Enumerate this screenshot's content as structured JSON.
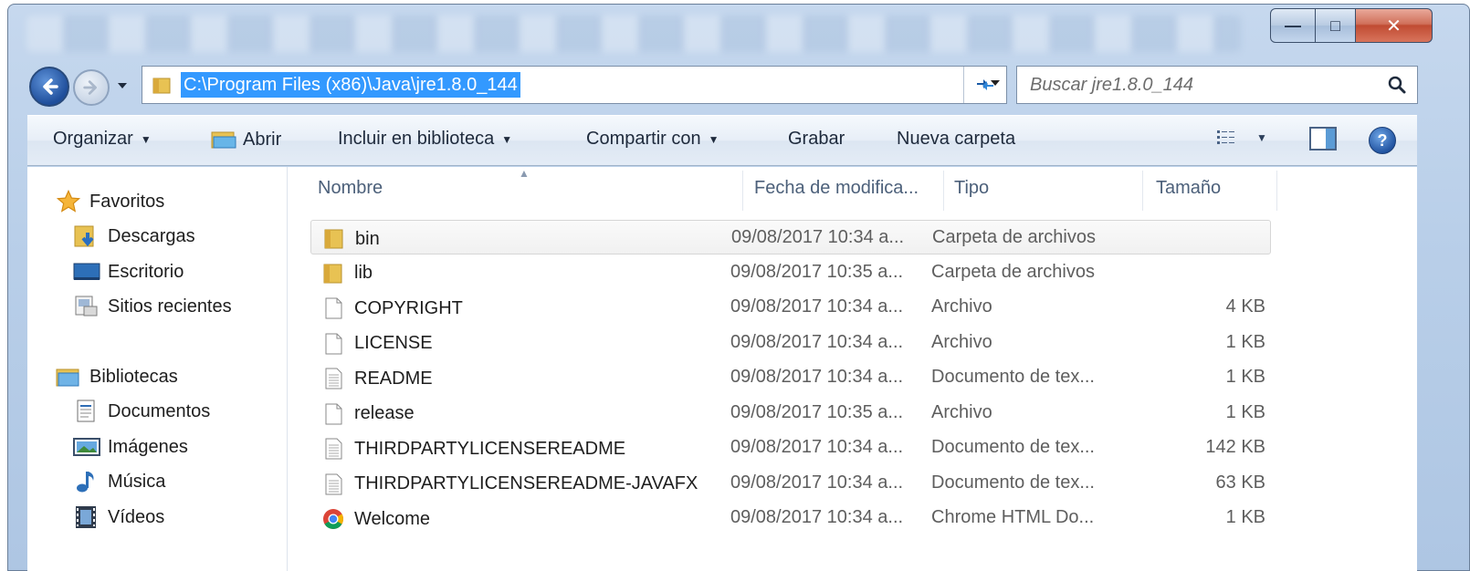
{
  "window": {
    "caption_min": "—",
    "caption_max": "□",
    "caption_close": "✕"
  },
  "address": {
    "path": "C:\\Program Files (x86)\\Java\\jre1.8.0_144",
    "search_placeholder": "Buscar jre1.8.0_144",
    "icons": [
      "back-arrow-icon",
      "forward-arrow-icon",
      "folder-icon",
      "refresh-icon",
      "search-icon"
    ]
  },
  "toolbar": {
    "organize": "Organizar",
    "open": "Abrir",
    "include_library": "Incluir en biblioteca",
    "share": "Compartir con",
    "burn": "Grabar",
    "new_folder": "Nueva carpeta",
    "help": "?"
  },
  "nav": {
    "favorites": "Favoritos",
    "downloads": "Descargas",
    "desktop": "Escritorio",
    "recent": "Sitios recientes",
    "libraries": "Bibliotecas",
    "documents": "Documentos",
    "images": "Imágenes",
    "music": "Música",
    "videos": "Vídeos"
  },
  "columns": {
    "name": "Nombre",
    "date": "Fecha de modifica...",
    "type": "Tipo",
    "size": "Tamaño"
  },
  "files": [
    {
      "name": "bin",
      "date": "09/08/2017 10:34 a...",
      "type": "Carpeta de archivos",
      "size": "",
      "icon": "folder-icon"
    },
    {
      "name": "lib",
      "date": "09/08/2017 10:35 a...",
      "type": "Carpeta de archivos",
      "size": "",
      "icon": "folder-icon"
    },
    {
      "name": "COPYRIGHT",
      "date": "09/08/2017 10:34 a...",
      "type": "Archivo",
      "size": "4 KB",
      "icon": "file-icon"
    },
    {
      "name": "LICENSE",
      "date": "09/08/2017 10:34 a...",
      "type": "Archivo",
      "size": "1 KB",
      "icon": "file-icon"
    },
    {
      "name": "README",
      "date": "09/08/2017 10:34 a...",
      "type": "Documento de tex...",
      "size": "1 KB",
      "icon": "text-file-icon"
    },
    {
      "name": "release",
      "date": "09/08/2017 10:35 a...",
      "type": "Archivo",
      "size": "1 KB",
      "icon": "file-icon"
    },
    {
      "name": "THIRDPARTYLICENSEREADME",
      "date": "09/08/2017 10:34 a...",
      "type": "Documento de tex...",
      "size": "142 KB",
      "icon": "text-file-icon"
    },
    {
      "name": "THIRDPARTYLICENSEREADME-JAVAFX",
      "date": "09/08/2017 10:34 a...",
      "type": "Documento de tex...",
      "size": "63 KB",
      "icon": "text-file-icon"
    },
    {
      "name": "Welcome",
      "date": "09/08/2017 10:34 a...",
      "type": "Chrome HTML Do...",
      "size": "1 KB",
      "icon": "chrome-icon"
    }
  ]
}
